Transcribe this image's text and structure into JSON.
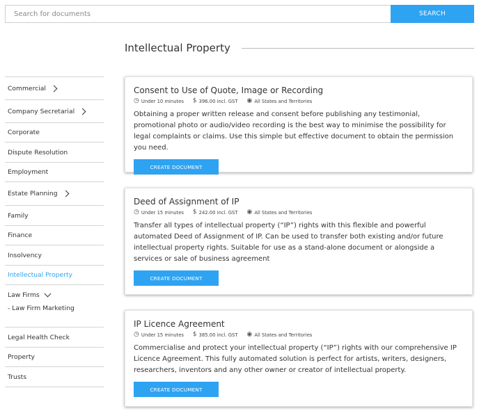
{
  "search": {
    "placeholder": "Search for documents",
    "button_label": "SEARCH"
  },
  "page": {
    "title": "Intellectual Property"
  },
  "colors": {
    "accent": "#2ea3f2"
  },
  "sidebar": {
    "items": [
      {
        "label": "Commercial",
        "chevron": "right"
      },
      {
        "label": "Company Secretarial",
        "chevron": "right"
      },
      {
        "label": "Corporate"
      },
      {
        "label": "Dispute Resolution"
      },
      {
        "label": "Employment"
      },
      {
        "label": "Estate Planning",
        "chevron": "right"
      },
      {
        "label": "Family"
      },
      {
        "label": "Finance"
      },
      {
        "label": "Insolvency"
      },
      {
        "label": "Intellectual Property",
        "active": true
      },
      {
        "label": "Law Firms",
        "chevron": "down",
        "sub": "- Law Firm Marketing"
      },
      {
        "label": "Legal Health Check"
      },
      {
        "label": "Property"
      },
      {
        "label": "Trusts"
      }
    ]
  },
  "documents": [
    {
      "title": "Consent to Use of Quote, Image or Recording",
      "time": "Under 10 minutes",
      "price": "396.00 incl. GST",
      "region": "All States and Territories",
      "description": "Obtaining a proper written release and consent before publishing any testimonial, promotional photo or audio/video recording is the best way to minimise the possibility for legal complaints or claims. Use this simple but effective document to obtain the permission you need.",
      "button_label": "CREATE DOCUMENT"
    },
    {
      "title": "Deed of Assignment of IP",
      "time": "Under 15 minutes",
      "price": "242.00 incl. GST",
      "region": "All States and Territories",
      "description": "Transfer all types of intellectual property (“IP”) rights with this flexible and powerful automated Deed of Assignment of IP. Can be used to transfer both existing and/or future intellectual property rights. Suitable for use as a stand-alone document or alongside a services or sale of business agreement",
      "button_label": "CREATE DOCUMENT"
    },
    {
      "title": "IP Licence Agreement",
      "time": "Under 15 minutes",
      "price": "385.00 incl. GST",
      "region": "All States and Territories",
      "description": "Commercialise and protect your intellectual property (“IP”) rights with our comprehensive IP Licence Agreement. This fully automated solution is perfect for artists, writers, designers, researchers, inventors and any other owner or creator of intellectual property.",
      "button_label": "CREATE DOCUMENT"
    }
  ],
  "icons": {
    "time": "clock-icon",
    "price": "dollar-icon",
    "region": "globe-icon"
  }
}
